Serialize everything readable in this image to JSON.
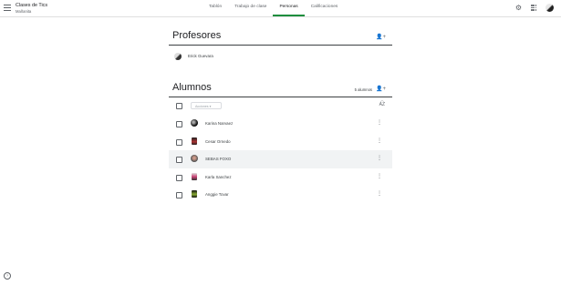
{
  "header": {
    "class_title": "Clases de Tics",
    "class_subtitle": "Mañanita",
    "tabs": [
      {
        "label": "Tablón"
      },
      {
        "label": "Trabajo de clase"
      },
      {
        "label": "Personas",
        "active": true
      },
      {
        "label": "Calificaciones"
      }
    ],
    "icons": [
      "menu-icon",
      "settings-icon",
      "apps-icon",
      "avatar"
    ]
  },
  "teachers": {
    "title": "Profesores",
    "add_icon": "person-add-icon",
    "items": [
      {
        "name": "Erick Guevara"
      }
    ]
  },
  "students": {
    "title": "Alumnos",
    "count_label": "5 alumnos",
    "actions_label": "Acciones",
    "items": [
      {
        "name": "Karina Narvaez"
      },
      {
        "name": "Cesar Ornedo"
      },
      {
        "name": "SEBAS FOXO",
        "highlighted": true
      },
      {
        "name": "Karla Sanchez"
      },
      {
        "name": "Anggie Tovar"
      }
    ]
  },
  "colors": {
    "accent": "#1e8e3e",
    "text": "#3c4043",
    "highlight": "#f1f3f4"
  }
}
